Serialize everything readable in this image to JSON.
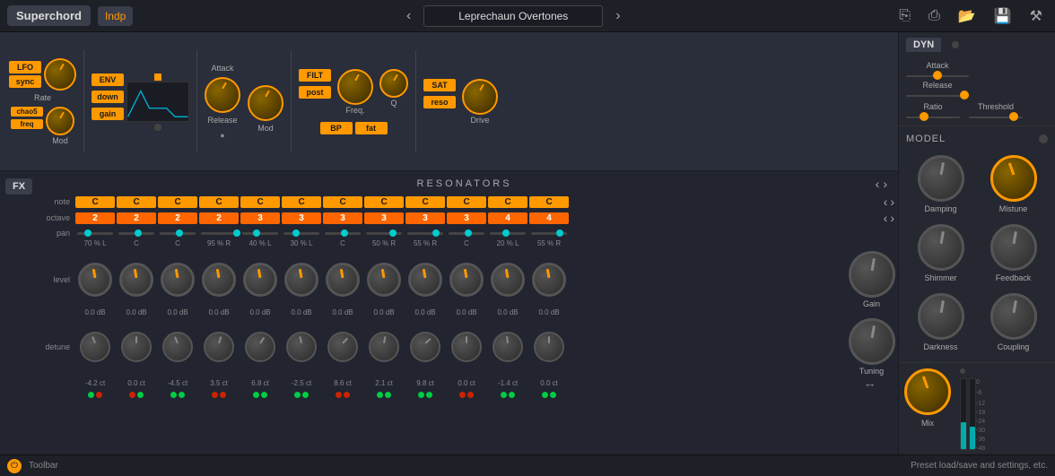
{
  "app": {
    "name": "Superchord",
    "logo": "Indp",
    "preset": "Leprechaun Overtones"
  },
  "toolbar": {
    "save_label": "Save",
    "load_label": "Load"
  },
  "lfo": {
    "title": "LFO",
    "sync_label": "sync",
    "freq_label": "freq",
    "mod_label": "Mod",
    "rate_label": "Rate",
    "chao_label": "chao5"
  },
  "env": {
    "title": "ENV",
    "gain_label": "gain",
    "down_label": "down",
    "attack_label": "Attack",
    "release_label": "Release",
    "mod_label": "Mod"
  },
  "filter": {
    "title": "FILT",
    "post_label": "post",
    "bp_label": "BP",
    "fat_label": "fat",
    "freq_label": "Freq.",
    "q_label": "Q"
  },
  "sat": {
    "title": "SAT",
    "reso_label": "reso",
    "drive_label": "Drive"
  },
  "dyn": {
    "title": "DYN",
    "attack_label": "Attack",
    "release_label": "Release",
    "ratio_label": "Ratio",
    "threshold_label": "Threshold"
  },
  "model": {
    "title": "MODEL",
    "damping_label": "Damping",
    "mistune_label": "Mistune",
    "shimmer_label": "Shimmer",
    "feedback_label": "Feedback",
    "darkness_label": "Darkness",
    "coupling_label": "Coupling",
    "mix_label": "Mix"
  },
  "resonators": {
    "title": "RESONATORS",
    "notes": [
      "C",
      "C",
      "C",
      "C",
      "C",
      "C",
      "C",
      "C",
      "C",
      "C",
      "C",
      "C"
    ],
    "octaves": [
      "2",
      "2",
      "2",
      "2",
      "3",
      "3",
      "3",
      "3",
      "3",
      "3",
      "4",
      "4"
    ],
    "pans": [
      "70 % L",
      "C",
      "C",
      "95 % R",
      "40 % L",
      "30 % L",
      "C",
      "50 % R",
      "55 % R",
      "C",
      "20 % L",
      "55 % R"
    ],
    "levels": [
      "0.0 dB",
      "0.0 dB",
      "0.0 dB",
      "0.0 dB",
      "0.0 dB",
      "0.0 dB",
      "0.0 dB",
      "0.0 dB",
      "0.0 dB",
      "0.0 dB",
      "0.0 dB",
      "0.0 dB"
    ],
    "detunings": [
      "-4.2 ct",
      "0.0 ct",
      "-4.5 ct",
      "3.5 ct",
      "6.8 ct",
      "-2.5 ct",
      "8.6 ct",
      "2.1 ct",
      "9.8 ct",
      "0.0 ct",
      "-1.4 ct",
      "0.0 ct"
    ],
    "gain_label": "Gain",
    "tuning_label": "Tuning"
  },
  "fx_btn": "FX",
  "bottom": {
    "toolbar_label": "Toolbar",
    "preset_label": "Preset load/save and settings, etc."
  }
}
